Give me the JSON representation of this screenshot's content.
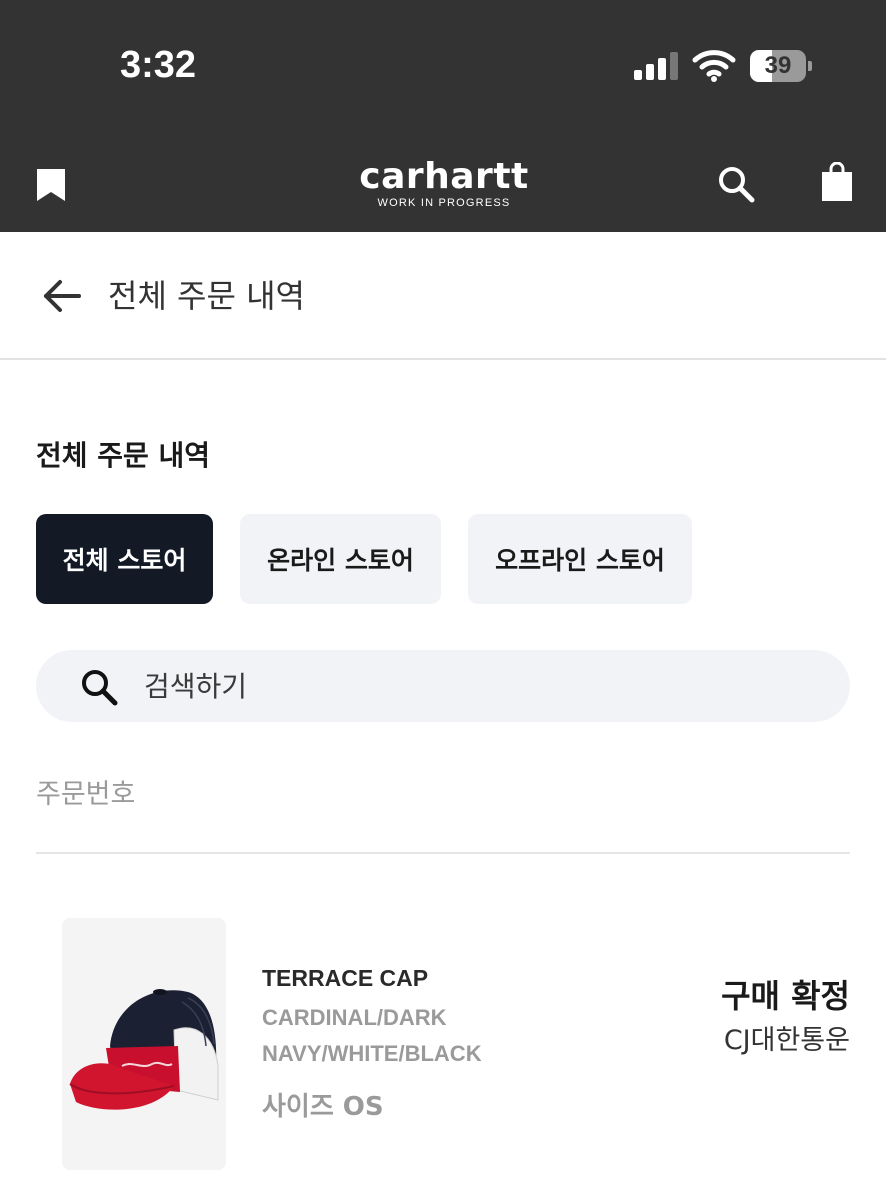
{
  "status_bar": {
    "time": "3:32",
    "battery_percent": "39",
    "battery_level": 0.39
  },
  "nav": {
    "logo_text": "carhartt",
    "logo_tagline": "WORK IN PROGRESS",
    "icons": [
      "bookmark-icon",
      "search-icon",
      "shopping-bag-icon"
    ]
  },
  "header": {
    "back_icon": "arrow-left-icon",
    "title": "전체 주문 내역"
  },
  "section": {
    "title": "전체 주문 내역"
  },
  "tabs": [
    {
      "label": "전체 스토어",
      "active": true
    },
    {
      "label": "온라인 스토어",
      "active": false
    },
    {
      "label": "오프라인 스토어",
      "active": false
    }
  ],
  "search": {
    "placeholder": "검색하기",
    "value": ""
  },
  "order": {
    "number_label": "주문번호",
    "item": {
      "name": "TERRACE CAP",
      "color": "CARDINAL/DARK NAVY/WHITE/BLACK",
      "size": "사이즈 OS",
      "status": "구매 확정",
      "courier": "CJ대한통운"
    }
  },
  "colors": {
    "topbar": "#333333",
    "active_tab": "#131a26",
    "tab_bg": "#f1f3f6",
    "muted_text": "#9a9a9a",
    "cap_red": "#c8102e",
    "cap_navy": "#1c2033"
  }
}
